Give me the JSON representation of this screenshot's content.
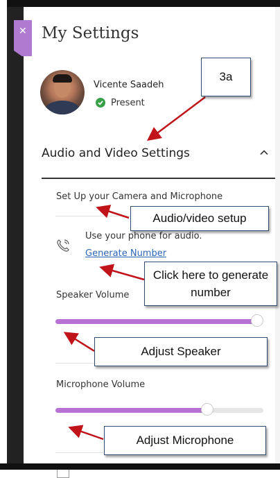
{
  "panel": {
    "title": "My Settings",
    "close_icon": "close-icon",
    "accent_color": "#b07ad0"
  },
  "user": {
    "name": "Vicente Saadeh",
    "status": "Present",
    "status_color": "#39a04a"
  },
  "section": {
    "title": "Audio and Video Settings",
    "collapse_icon": "chevron-up-icon"
  },
  "audio": {
    "setup_label": "Set Up your Camera and Microphone",
    "phone_text": "Use your phone for audio.",
    "generate_label": "Generate Number",
    "speaker_label": "Speaker Volume",
    "speaker_level": 0.97,
    "mic_label": "Microphone Volume",
    "mic_level": 0.73
  },
  "annotations": {
    "step": "3a",
    "setup": "Audio/video setup",
    "generate": "Click here to generate number",
    "speaker": "Adjust Speaker",
    "mic": "Adjust Microphone"
  }
}
